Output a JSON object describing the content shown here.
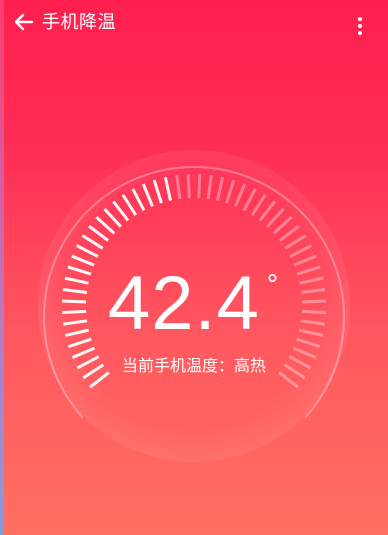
{
  "app_bar": {
    "title": "手机降温",
    "back_icon": "arrow-left-icon",
    "menu_icon": "more-vertical-icon"
  },
  "thermometer": {
    "value": "42.4",
    "unit": "°",
    "status_label": "当前手机温度",
    "separator": "：",
    "status_value": "高热"
  },
  "colors": {
    "gradient_top": "#ff1f4f",
    "gradient_bottom": "#ff7060",
    "text": "#ffffff"
  }
}
